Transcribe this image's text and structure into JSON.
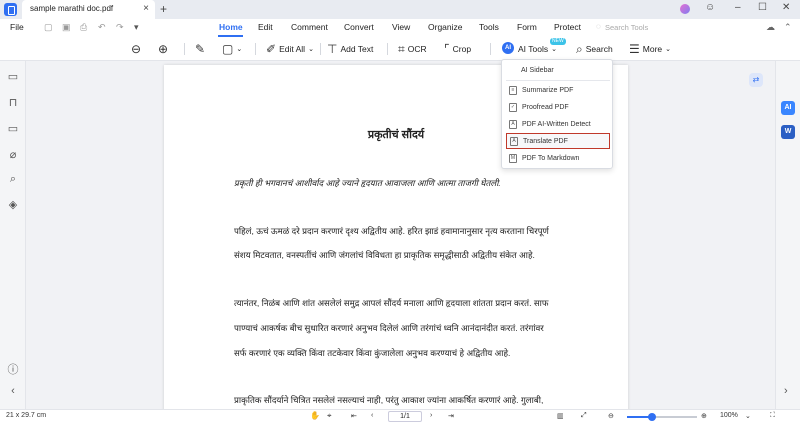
{
  "titlebar": {
    "tab_label": "sample marathi doc.pdf",
    "close_glyph": "×",
    "new_tab_glyph": "+"
  },
  "menubar": {
    "file": "File",
    "items": [
      "Home",
      "Edit",
      "Comment",
      "Convert",
      "View",
      "Organize",
      "Tools",
      "Form",
      "Protect"
    ],
    "search_tools": "Search Tools"
  },
  "toolbar": {
    "edit_all": "Edit All",
    "add_text": "Add Text",
    "ocr": "OCR",
    "crop": "Crop",
    "ai_tools": "AI Tools",
    "ai_badge": "AI",
    "new_badge": "NEW",
    "search": "Search",
    "more": "More"
  },
  "ai_menu": {
    "items": [
      "AI Sidebar",
      "Summarize PDF",
      "Proofread PDF",
      "PDF AI-Written Detect",
      "Translate PDF",
      "PDF To Markdown"
    ],
    "highlighted": "Translate PDF"
  },
  "document": {
    "title": "प्रकृतीचं सौंदर्य",
    "lines": [
      "प्रकृती ही भगवानचं आशीर्वाद आहे ज्याने हृदयात आवाजला आणि आत्मा ताजगी घेतली.",
      "पहिलं, ऊचं ऊमळं दरे प्रदान करणारं दृश्य अद्वितीय आहे. हरित झाडं हवामानानुसार नृत्य करताना चिरपूर्ण",
      "संशय मिटवतात, वनस्पतींचं आणि जंगलांचं विविधता हा प्राकृतिक समृद्धीसाठी अद्वितीय संकेत आहे.",
      "त्यानंतर, निळंब आणि शांत असलेलं समुद्र आपलं सौंदर्य मनाला आणि हृदयाला शांतता प्रदान करतं. साफ",
      "पाण्याचं आकर्षक बीच सुधारित करणारं अनुभव दिलेलं आणि तरंगांचं ध्वनि आनंदानंदीत करतं. तरंगांवर",
      "सर्फ करणारं एक व्यक्ति किंवा तटकेवार किंवा कुंजालेला अनुभव करण्याचं हे अद्वितीय आहे.",
      "प्राकृतिक सौंदर्याने चित्रित नसलेलं नसल्याचं नाही, परंतु आकाश ज्यांना आकर्षित करणारं आहे. गुलाबी,"
    ]
  },
  "statusbar": {
    "page_size": "21 x 29.7 cm",
    "page_number": "1/1",
    "zoom": "100%",
    "zoom_fraction": 0.3
  },
  "sidebar_right": {
    "ai_label": "AI",
    "word_label": "W"
  },
  "colors": {
    "accent": "#2f6ff2",
    "highlight_border": "#c0392b"
  }
}
